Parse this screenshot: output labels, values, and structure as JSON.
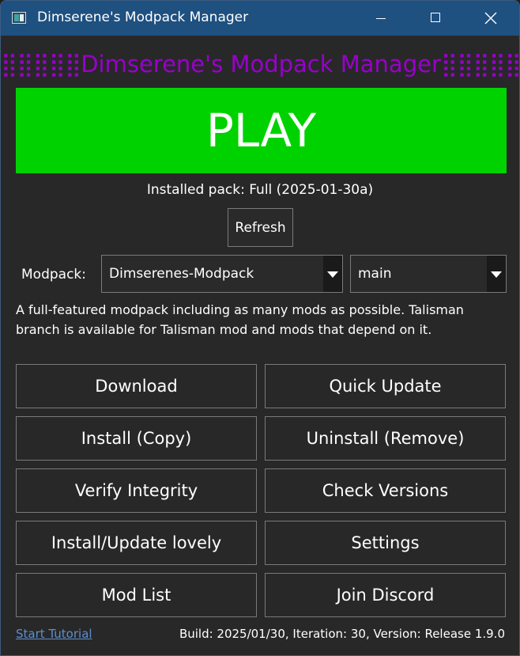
{
  "window": {
    "title": "Dimserene's Modpack Manager"
  },
  "header": {
    "deco_left": "⣿⣿⣿⣿⣿",
    "title": "Dimserene's Modpack Manager",
    "deco_right": "⣿⣿⣿⣿⣿",
    "color": "#9900cc"
  },
  "play": {
    "label": "PLAY",
    "color": "#00d200"
  },
  "installed_pack": "Installed pack: Full (2025-01-30a)",
  "refresh_label": "Refresh",
  "modpack_label": "Modpack:",
  "modpack_select": "Dimserenes-Modpack",
  "branch_select": "main",
  "description": "A full-featured modpack including as many mods as possible. Talisman branch is available for Talisman mod and mods that depend on it.",
  "buttons": {
    "download": "Download",
    "quick_update": "Quick Update",
    "install": "Install (Copy)",
    "uninstall": "Uninstall (Remove)",
    "verify": "Verify Integrity",
    "check_versions": "Check Versions",
    "lovely": "Install/Update lovely",
    "settings": "Settings",
    "mod_list": "Mod List",
    "discord": "Join Discord"
  },
  "footer": {
    "tutorial": "Start Tutorial",
    "build": "Build: 2025/01/30, Iteration: 30, Version: Release 1.9.0"
  }
}
